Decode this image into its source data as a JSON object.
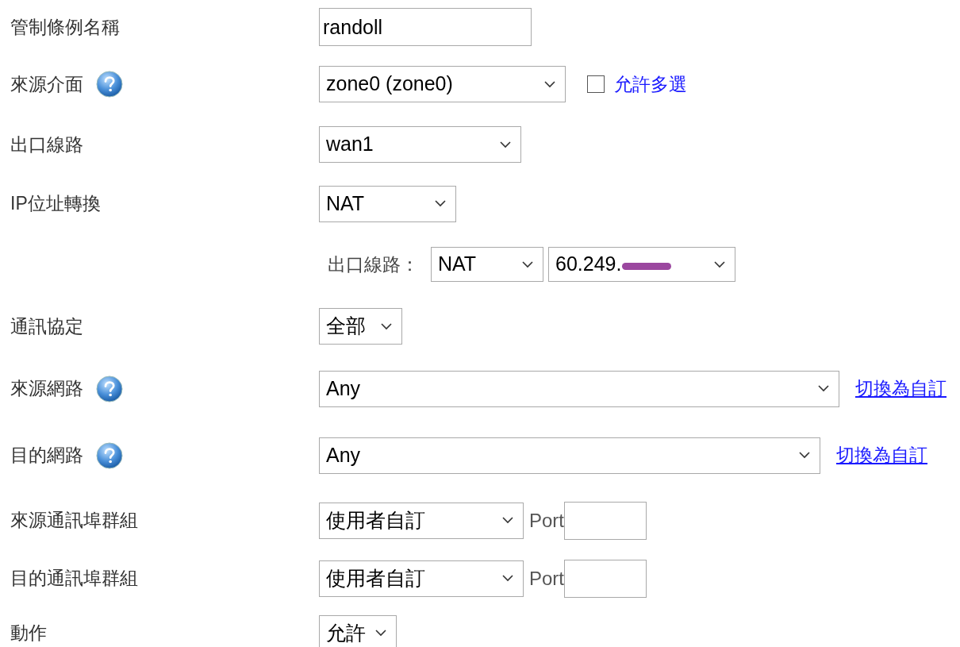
{
  "rows": [
    {
      "kind": "text",
      "label": "管制條例名稱",
      "help": false,
      "value": "randoll"
    },
    {
      "kind": "select",
      "label": "來源介面",
      "help": true,
      "value": "zone0 (zone0)",
      "checkbox": {
        "label": "允許多選",
        "checked": false
      }
    },
    {
      "kind": "select",
      "label": "出口線路",
      "help": false,
      "value": "wan1"
    },
    {
      "kind": "select",
      "label": "IP位址轉換",
      "help": false,
      "value": "NAT"
    },
    {
      "kind": "nat",
      "sublabel": "出口線路：",
      "values": [
        "NAT",
        "60.249."
      ],
      "redacted": true
    },
    {
      "kind": "select",
      "label": "通訊協定",
      "help": false,
      "value": "全部"
    },
    {
      "kind": "select",
      "label": "來源網路",
      "help": true,
      "value": "Any",
      "link": "切換為自訂"
    },
    {
      "kind": "select",
      "label": "目的網路",
      "help": true,
      "value": "Any",
      "link": "切換為自訂"
    },
    {
      "kind": "port",
      "label": "來源通訊埠群組",
      "help": false,
      "value": "使用者自訂",
      "port_label": "Port"
    },
    {
      "kind": "port",
      "label": "目的通訊埠群組",
      "help": false,
      "value": "使用者自訂",
      "port_label": "Port"
    },
    {
      "kind": "select",
      "label": "動作",
      "help": false,
      "value": "允許"
    }
  ]
}
